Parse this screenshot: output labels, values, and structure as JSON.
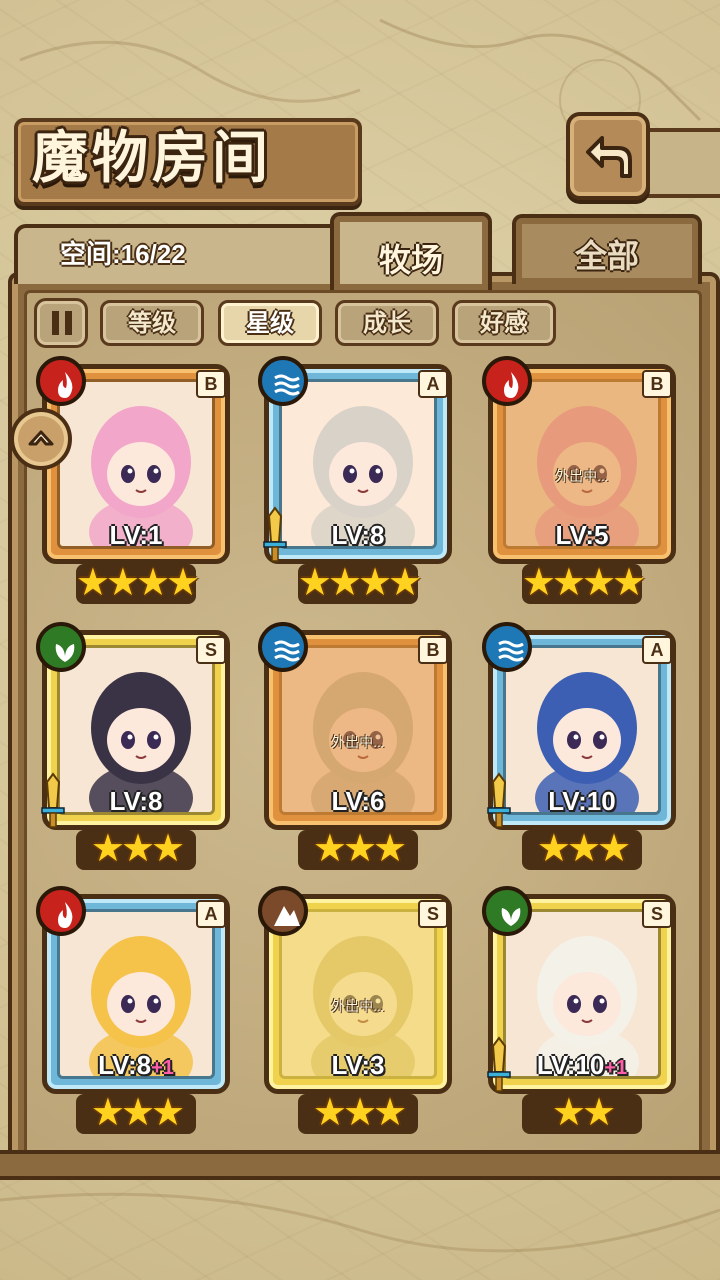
{
  "header": {
    "title": "魔物房间",
    "back_icon": "back-arrow-icon"
  },
  "space": {
    "label": "空间:16/22"
  },
  "tabs": [
    {
      "label": "牧场",
      "active": true
    },
    {
      "label": "全部",
      "active": false
    }
  ],
  "sort": {
    "pause_icon": "pause-icon",
    "options": [
      {
        "label": "等级",
        "active": false
      },
      {
        "label": "星级",
        "active": true
      },
      {
        "label": "成长",
        "active": false
      },
      {
        "label": "好感",
        "active": false
      }
    ]
  },
  "colors": {
    "fire": "#c8221c",
    "water": "#1f78b6",
    "wood": "#2f7a24",
    "earth": "#7a4a2a",
    "frame_orange": "#e0913d",
    "frame_blue": "#6fb7d9",
    "frame_yellow": "#f0d24d"
  },
  "monsters": [
    {
      "element": "fire",
      "rank": "B",
      "level": "LV:1",
      "bonus": "",
      "stars": "★★★★",
      "away": ""
    },
    {
      "element": "water",
      "rank": "A",
      "level": "LV:8",
      "bonus": "",
      "stars": "★★★★",
      "away": ""
    },
    {
      "element": "fire",
      "rank": "B",
      "level": "LV:5",
      "bonus": "",
      "stars": "★★★★",
      "away": "外出中..."
    },
    {
      "element": "wood",
      "rank": "S",
      "level": "LV:8",
      "bonus": "",
      "stars": "★★★",
      "away": ""
    },
    {
      "element": "water",
      "rank": "B",
      "level": "LV:6",
      "bonus": "",
      "stars": "★★★",
      "away": "外出中..."
    },
    {
      "element": "water",
      "rank": "A",
      "level": "LV:10",
      "bonus": "",
      "stars": "★★★",
      "away": ""
    },
    {
      "element": "fire",
      "rank": "A",
      "level": "LV:8",
      "bonus": "+1",
      "stars": "★★★",
      "away": ""
    },
    {
      "element": "earth",
      "rank": "S",
      "level": "LV:3",
      "bonus": "",
      "stars": "★★★",
      "away": "外出中..."
    },
    {
      "element": "wood",
      "rank": "S",
      "level": "LV:10",
      "bonus": "+1",
      "stars": "★★",
      "away": ""
    }
  ]
}
